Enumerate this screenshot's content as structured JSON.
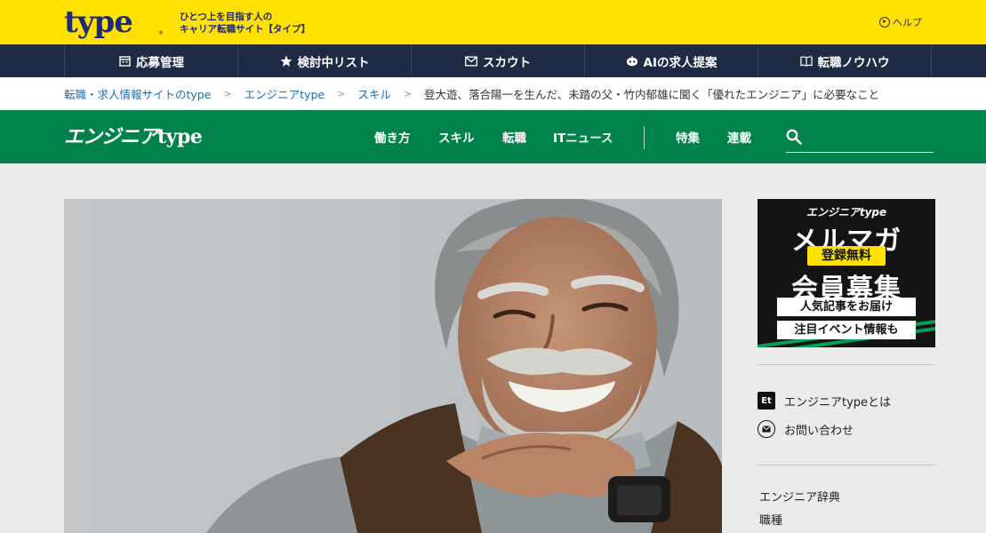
{
  "header": {
    "logo_text": "type",
    "logo_mark": "®",
    "tagline_line1": "ひとつ上を目指す人の",
    "tagline_line2": "キャリア転職サイト【タイプ】",
    "help_label": "ヘルプ"
  },
  "main_nav": {
    "items": [
      {
        "label": "応募管理",
        "icon": "calendar-icon"
      },
      {
        "label": "検討中リスト",
        "icon": "star-icon"
      },
      {
        "label": "スカウト",
        "icon": "mail-icon"
      },
      {
        "label": "AIの求人提案",
        "icon": "robot-icon"
      },
      {
        "label": "転職ノウハウ",
        "icon": "book-icon"
      }
    ]
  },
  "breadcrumb": {
    "items": [
      "転職・求人情報サイトのtype",
      "エンジニアtype",
      "スキル"
    ],
    "current": "登大遊、落合陽一を生んだ、未踏の父・竹内郁雄に聞く「優れたエンジニア」に必要なこと"
  },
  "site_header": {
    "logo_kana": "エンジニア",
    "logo_type": "type",
    "nav_left": [
      "働き方",
      "スキル",
      "転職",
      "ITニュース"
    ],
    "nav_right": [
      "特集",
      "連載"
    ],
    "search_placeholder": ""
  },
  "sidebar": {
    "banner": {
      "logo": "エンジニアtype",
      "line1": "メルマガ",
      "pill": "登録無料",
      "line2": "会員募集",
      "bar1": "人気記事をお届け",
      "bar2": "注目イベント情報も"
    },
    "links": [
      {
        "label": "エンジニアtypeとは",
        "icon": "et-icon"
      },
      {
        "label": "お問い合わせ",
        "icon": "mail-icon"
      }
    ],
    "section_items": [
      "エンジニア辞典",
      "職種"
    ]
  },
  "colors": {
    "brand_yellow": "#ffe100",
    "nav_navy": "#1f2a44",
    "site_green": "#00824a",
    "link_blue": "#1a6fb5"
  }
}
